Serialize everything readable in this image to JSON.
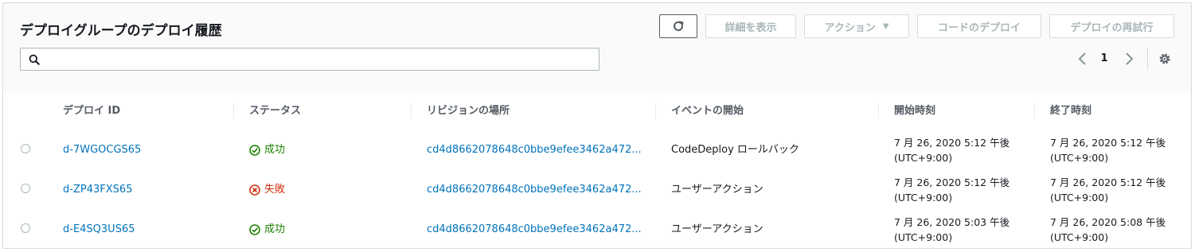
{
  "panel": {
    "title": "デプロイグループのデプロイ履歴",
    "buttons": {
      "details": "詳細を表示",
      "actions": "アクション",
      "deploy": "コードのデプロイ",
      "redeploy": "デプロイの再試行"
    },
    "search": {
      "value": "",
      "placeholder": ""
    },
    "pagination": {
      "page": "1"
    }
  },
  "table": {
    "headers": [
      "デプロイ ID",
      "ステータス",
      "リビジョンの場所",
      "イベントの開始",
      "開始時刻",
      "終了時刻"
    ],
    "rows": [
      {
        "id": "d-7WGOCGS65",
        "status": "成功",
        "status_type": "success",
        "revision": "cd4d8662078648c0bbe9efee3462a472...",
        "event": "CodeDeploy ロールバック",
        "start_line1": "7 月 26, 2020 5:12 午後",
        "start_line2": "(UTC+9:00)",
        "end_line1": "7 月 26, 2020 5:12 午後",
        "end_line2": "(UTC+9:00)"
      },
      {
        "id": "d-ZP43FXS65",
        "status": "失敗",
        "status_type": "failure",
        "revision": "cd4d8662078648c0bbe9efee3462a472...",
        "event": "ユーザーアクション",
        "start_line1": "7 月 26, 2020 5:12 午後",
        "start_line2": "(UTC+9:00)",
        "end_line1": "7 月 26, 2020 5:12 午後",
        "end_line2": "(UTC+9:00)"
      },
      {
        "id": "d-E4SQ3US65",
        "status": "成功",
        "status_type": "success",
        "revision": "cd4d8662078648c0bbe9efee3462a472...",
        "event": "ユーザーアクション",
        "start_line1": "7 月 26, 2020 5:03 午後",
        "start_line2": "(UTC+9:00)",
        "end_line1": "7 月 26, 2020 5:08 午後",
        "end_line2": "(UTC+9:00)"
      }
    ]
  },
  "icons": {
    "refresh": "refresh-icon",
    "search": "search-icon",
    "prev": "chevron-left-icon",
    "next": "chevron-right-icon",
    "settings": "gear-icon",
    "success": "check-circle-icon",
    "failure": "x-circle-icon"
  },
  "colors": {
    "link": "#0073bb",
    "success": "#1d8102",
    "failure": "#d13212",
    "disabled_text": "#aab7b8"
  }
}
